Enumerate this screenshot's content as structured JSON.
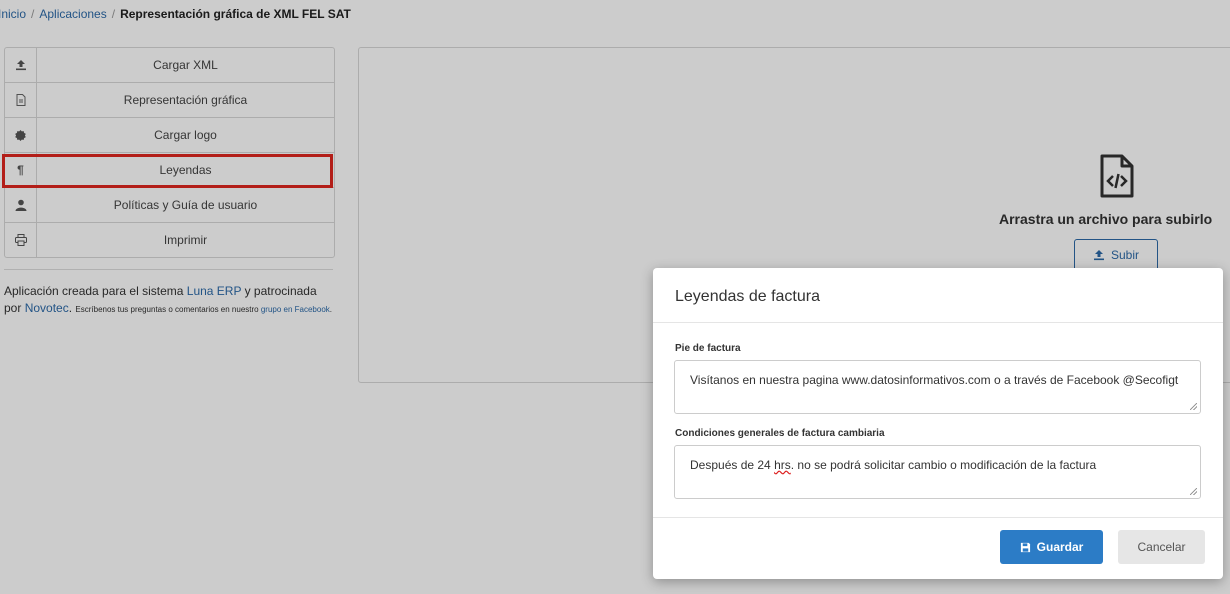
{
  "breadcrumb": {
    "home": "Inicio",
    "apps": "Aplicaciones",
    "current": "Representación gráfica de XML FEL SAT"
  },
  "menu": {
    "items": [
      {
        "icon": "upload-icon",
        "label": "Cargar XML"
      },
      {
        "icon": "document-icon",
        "label": "Representación gráfica"
      },
      {
        "icon": "badge-icon",
        "label": "Cargar logo"
      },
      {
        "icon": "pilcrow-icon",
        "label": "Leyendas"
      },
      {
        "icon": "user-icon",
        "label": "Políticas y Guía de usuario"
      },
      {
        "icon": "print-icon",
        "label": "Imprimir"
      }
    ]
  },
  "about": {
    "text1": "Aplicación creada para el sistema ",
    "link_luna": "Luna ERP",
    "text2": " y patrocinada por ",
    "link_novotec": "Novotec",
    "text3": ". ",
    "small_text": "Escríbenos tus preguntas o comentarios en nuestro ",
    "link_group": "grupo en Facebook",
    "end": "."
  },
  "dropzone": {
    "text": "Arrastra un archivo para subirlo",
    "button": "Subir"
  },
  "modal": {
    "title": "Leyendas de factura",
    "field1_label": "Pie de factura",
    "field1_value": "Visítanos en nuestra pagina www.datosinformativos.com o a través de Facebook @Secofigt",
    "field2_label": "Condiciones generales de factura cambiaria",
    "field2_value_a": "Después de 24 ",
    "field2_value_b": "hrs",
    "field2_value_c": ". no se podrá solicitar cambio o modificación de la factura",
    "save": "Guardar",
    "cancel": "Cancelar"
  },
  "colors": {
    "link": "#2c6aa8",
    "primary": "#2c7cc6",
    "highlight": "#e0261f"
  }
}
